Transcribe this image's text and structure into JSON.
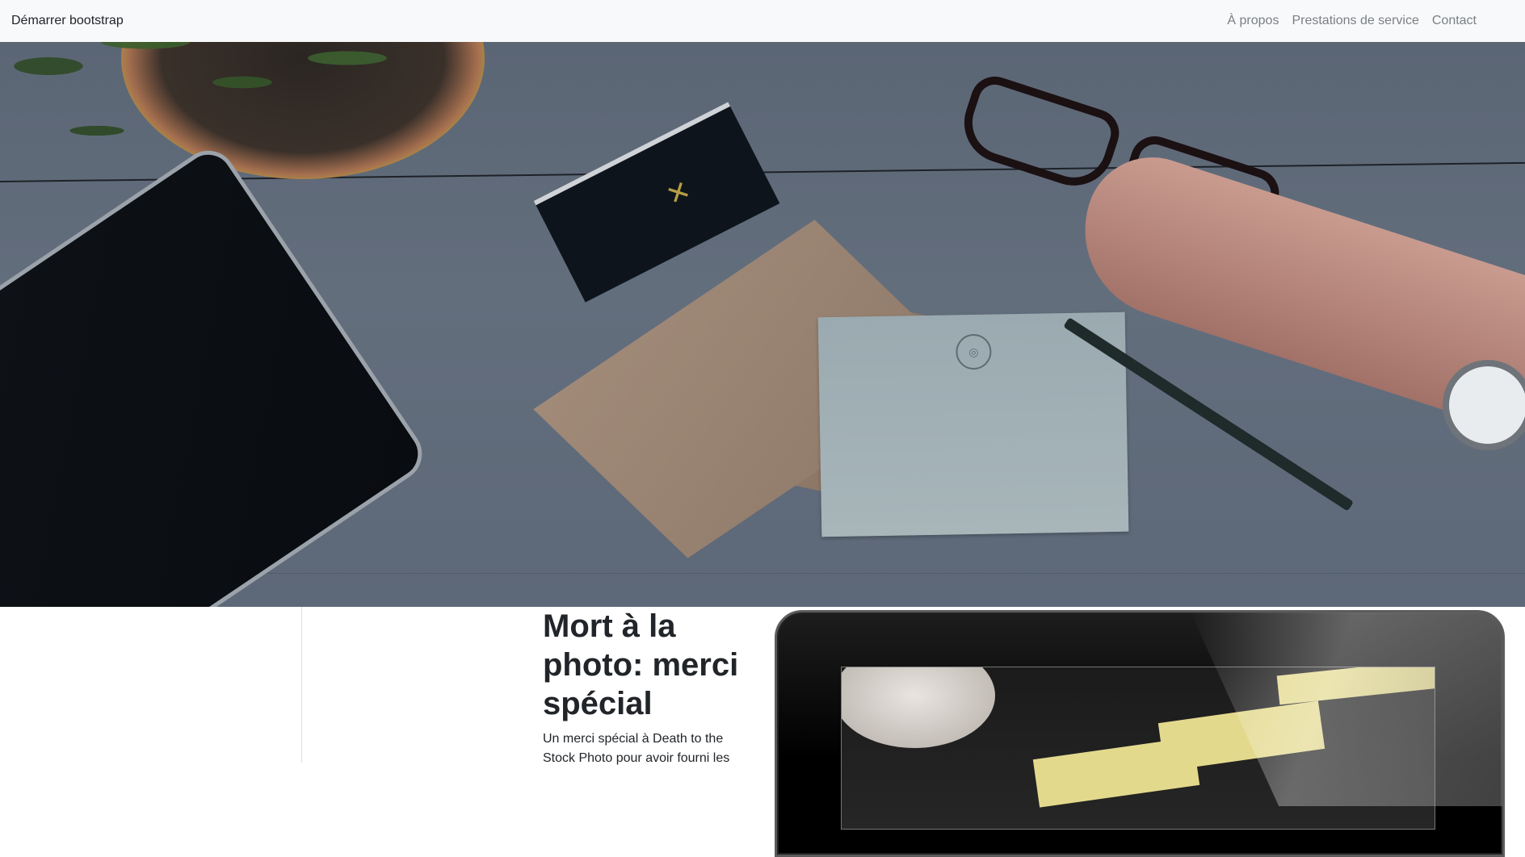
{
  "navbar": {
    "brand": "Démarrer bootstrap",
    "links": [
      {
        "label": "À propos"
      },
      {
        "label": "Prestations de service"
      },
      {
        "label": "Contact"
      }
    ]
  },
  "hero": {
    "image_subject": "desk-flatlay-photo"
  },
  "section": {
    "title": "Mort à la photo: merci spécial",
    "text": "Un merci spécial à Death to the Stock Photo pour avoir fourni les"
  },
  "colors": {
    "navbar_bg": "#f8f9fa",
    "nav_link": "#7b7f84",
    "text": "#212529"
  }
}
